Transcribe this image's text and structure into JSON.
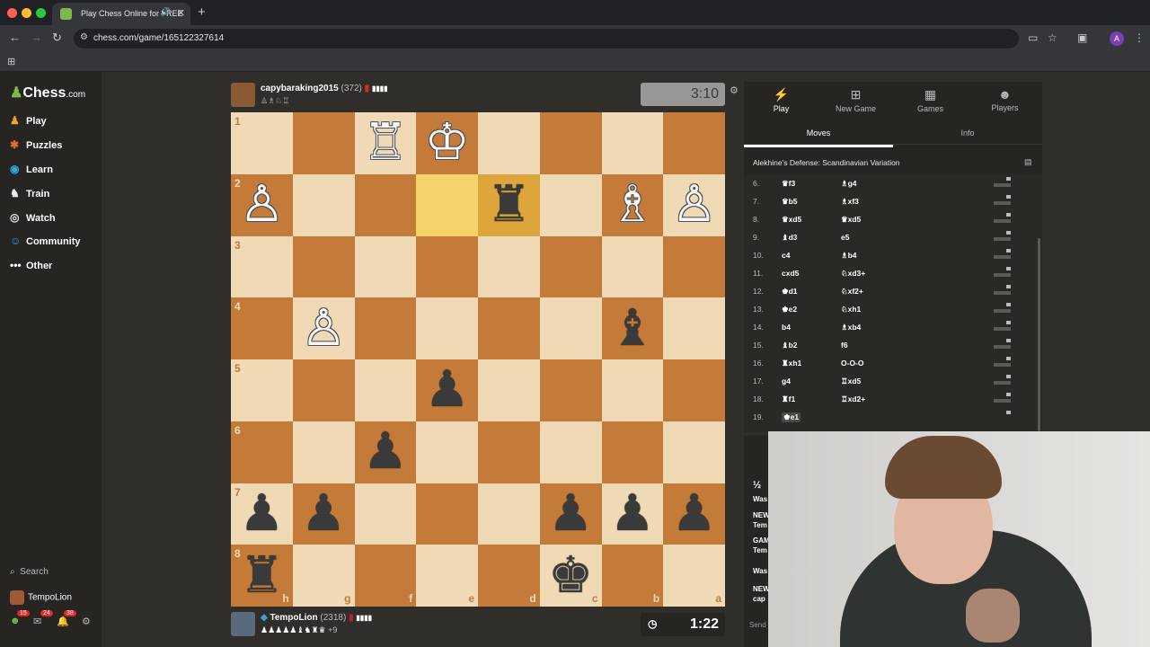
{
  "browser": {
    "tab_title": "Play Chess Online for FREE",
    "url": "chess.com/game/165122327614",
    "profile_initial": "A"
  },
  "sidebar": {
    "logo": "Chess",
    "logo_suffix": ".com",
    "items": [
      {
        "label": "Play",
        "icon": "play-icon"
      },
      {
        "label": "Puzzles",
        "icon": "puzzle-icon"
      },
      {
        "label": "Learn",
        "icon": "learn-icon"
      },
      {
        "label": "Train",
        "icon": "train-icon"
      },
      {
        "label": "Watch",
        "icon": "watch-icon"
      },
      {
        "label": "Community",
        "icon": "community-icon"
      },
      {
        "label": "Other",
        "icon": "more-icon"
      }
    ],
    "search_label": "Search",
    "username": "TempoLion",
    "badges": [
      "15",
      "24",
      "38"
    ]
  },
  "top_player": {
    "name": "capybaraking2015",
    "rating": "(372)",
    "clock": "3:10"
  },
  "bottom_player": {
    "name": "TempoLion",
    "rating": "(2318)",
    "material": "+9",
    "clock": "1:22"
  },
  "board": {
    "ranks": [
      "1",
      "2",
      "3",
      "4",
      "5",
      "6",
      "7",
      "8"
    ],
    "files": [
      "h",
      "g",
      "f",
      "e",
      "d",
      "c",
      "b",
      "a"
    ],
    "pieces": [
      [
        "",
        "",
        "♖",
        "♔",
        "",
        "",
        "",
        ""
      ],
      [
        "♙",
        "",
        "",
        "",
        "♜",
        "",
        "♗",
        "♙"
      ],
      [
        "",
        "",
        "",
        "",
        "",
        "",
        "",
        ""
      ],
      [
        "",
        "♙",
        "",
        "",
        "",
        "",
        "♝",
        ""
      ],
      [
        "",
        "",
        "",
        "♟",
        "",
        "",
        "",
        ""
      ],
      [
        "",
        "",
        "♟",
        "",
        "",
        "",
        "",
        ""
      ],
      [
        "♟",
        "♟",
        "",
        "",
        "",
        "♟",
        "♟",
        "♟"
      ],
      [
        "♜",
        "",
        "",
        "",
        "",
        "♚",
        "",
        ""
      ]
    ],
    "highlight": [
      [
        1,
        3
      ],
      [
        1,
        4
      ]
    ]
  },
  "panel": {
    "tabs": [
      {
        "label": "Play",
        "icon": "bolt-icon"
      },
      {
        "label": "New Game",
        "icon": "plus-icon"
      },
      {
        "label": "Games",
        "icon": "board-icon"
      },
      {
        "label": "Players",
        "icon": "players-icon"
      }
    ],
    "subtabs": [
      "Moves",
      "Info"
    ],
    "opening": "Alekhine's Defense: Scandinavian Variation",
    "moves": [
      {
        "n": "6.",
        "w": "♛f3",
        "b": "♗g4"
      },
      {
        "n": "7.",
        "w": "♛b5",
        "b": "♗xf3"
      },
      {
        "n": "8.",
        "w": "♛xd5",
        "b": "♛xd5"
      },
      {
        "n": "9.",
        "w": "♝d3",
        "b": "e5"
      },
      {
        "n": "10.",
        "w": "c4",
        "b": "♗b4"
      },
      {
        "n": "11.",
        "w": "cxd5",
        "b": "♘xd3+"
      },
      {
        "n": "12.",
        "w": "♚d1",
        "b": "♘xf2+"
      },
      {
        "n": "13.",
        "w": "♚e2",
        "b": "♘xh1"
      },
      {
        "n": "14.",
        "w": "b4",
        "b": "♗xb4"
      },
      {
        "n": "15.",
        "w": "♝b2",
        "b": "f6"
      },
      {
        "n": "16.",
        "w": "♜xh1",
        "b": "O-O-O"
      },
      {
        "n": "17.",
        "w": "g4",
        "b": "♖xd5"
      },
      {
        "n": "18.",
        "w": "♜f1",
        "b": "♖xd2+"
      },
      {
        "n": "19.",
        "w": "♚e1",
        "b": ""
      }
    ]
  },
  "chat": {
    "half_label": "½",
    "lines": [
      "Was",
      "NEW",
      "Tem",
      "GAM",
      "Tem",
      "Was",
      "NEW",
      "cap"
    ],
    "send": "Send"
  }
}
